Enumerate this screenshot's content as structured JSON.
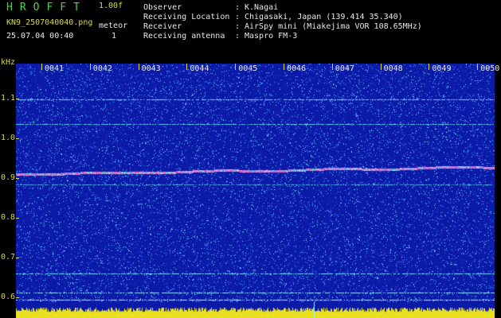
{
  "header": {
    "brand": "HROFFT",
    "version": "1.00f",
    "filename": "KN9_2507040040.png",
    "timestamp": "25.07.04 00:40",
    "meteor_label": "meteor",
    "meteor_count": "1"
  },
  "station_info": [
    {
      "key": "Observer",
      "sep": ":",
      "value": "K.Nagai"
    },
    {
      "key": "Receiving Location",
      "sep": ":",
      "value": "Chigasaki, Japan (139.414 35.340)"
    },
    {
      "key": "Receiver",
      "sep": ":",
      "value": "AirSpy mini (Miakejima VOR 108.65MHz)"
    },
    {
      "key": "Receiving antenna",
      "sep": ":",
      "value": "Maspro FM-3"
    }
  ],
  "chart_data": {
    "type": "heatmap",
    "ylabel": "kHz",
    "y_ticks": [
      "1.1",
      "1.0",
      "0.9",
      "0.8",
      "0.7",
      "0.6"
    ],
    "x_ticks": [
      "0041",
      "0042",
      "0043",
      "0044",
      "0045",
      "0046",
      "0047",
      "0048",
      "0049",
      "0050"
    ],
    "colors": {
      "background": "#0c1aa8",
      "noise": "#3fa8ff",
      "carrier": "#e04bd0",
      "baseline": "#e8e020",
      "axis": "#d8d84a"
    }
  }
}
